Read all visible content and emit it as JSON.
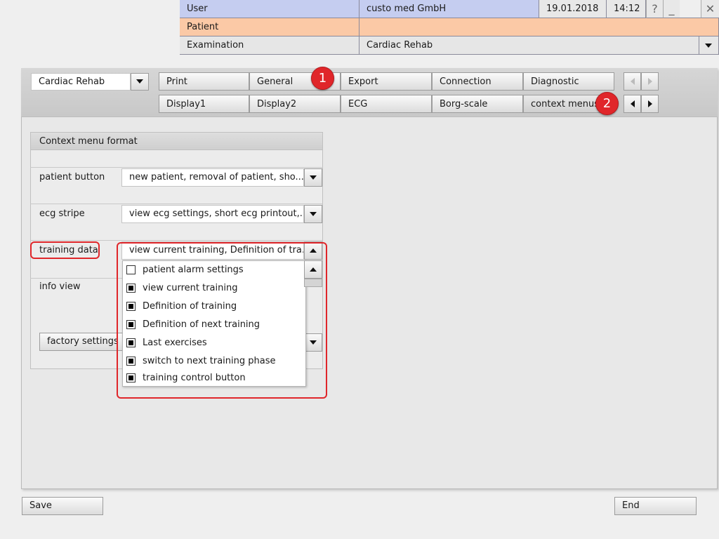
{
  "header": {
    "user_label": "User",
    "user_value": "custo med GmbH",
    "date": "19.01.2018",
    "time": "14:12",
    "help_glyph": "?",
    "minimize_glyph": "_",
    "close_glyph": "✕",
    "patient_label": "Patient",
    "patient_value": "",
    "exam_label": "Examination",
    "exam_value": "Cardiac Rehab"
  },
  "toolbar": {
    "module_select": "Cardiac Rehab",
    "tabs_row1": [
      "Print",
      "General",
      "Export",
      "Connection",
      "Diagnostic"
    ],
    "tabs_row2": [
      "Display1",
      "Display2",
      "ECG",
      "Borg-scale",
      "context menus"
    ],
    "active_tab": "context menus"
  },
  "annotations": {
    "badge1": "1",
    "badge2": "2"
  },
  "group": {
    "title": "Context menu format",
    "rows": [
      {
        "label": "patient button",
        "value": "new patient, removal of patient, sho..."
      },
      {
        "label": "ecg stripe",
        "value": "view ecg settings, short ecg printout,..."
      },
      {
        "label": "training data",
        "value": "view current training, Definition of tra..."
      },
      {
        "label": "info view",
        "value": ""
      }
    ],
    "factory_button": "factory settings"
  },
  "dropdown": {
    "items": [
      {
        "label": "patient alarm settings",
        "checked": false
      },
      {
        "label": "view current training",
        "checked": true
      },
      {
        "label": "Definition of training",
        "checked": true
      },
      {
        "label": "Definition of next training",
        "checked": true
      },
      {
        "label": "Last exercises",
        "checked": true
      },
      {
        "label": "switch to next training phase",
        "checked": true
      },
      {
        "label": "training control button",
        "checked": true
      }
    ]
  },
  "footer": {
    "save": "Save",
    "end": "End"
  },
  "colors": {
    "user_row": "#c5cdf0",
    "patient_row": "#fbc9a6",
    "annotation_red": "#e0262a"
  }
}
